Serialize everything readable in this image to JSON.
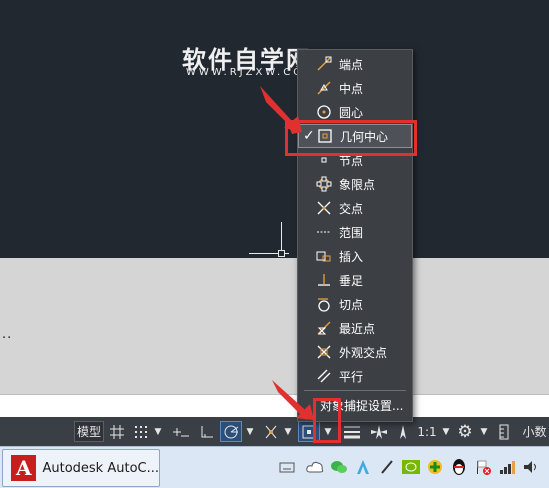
{
  "watermark": {
    "title": "软件自学网",
    "url": "WWW.RJZXW.COM"
  },
  "command": {
    "history_text": ".."
  },
  "snap_menu": {
    "items": [
      {
        "label": "端点",
        "icon": "endpoint-icon",
        "checked": false
      },
      {
        "label": "中点",
        "icon": "midpoint-icon",
        "checked": false
      },
      {
        "label": "圆心",
        "icon": "center-icon",
        "checked": false
      },
      {
        "label": "几何中心",
        "icon": "geometric-center-icon",
        "checked": true
      },
      {
        "label": "节点",
        "icon": "node-icon",
        "checked": false
      },
      {
        "label": "象限点",
        "icon": "quadrant-icon",
        "checked": false
      },
      {
        "label": "交点",
        "icon": "intersection-icon",
        "checked": false
      },
      {
        "label": "范围",
        "icon": "extension-icon",
        "checked": false
      },
      {
        "label": "插入",
        "icon": "insertion-icon",
        "checked": false
      },
      {
        "label": "垂足",
        "icon": "perpendicular-icon",
        "checked": false
      },
      {
        "label": "切点",
        "icon": "tangent-icon",
        "checked": false
      },
      {
        "label": "最近点",
        "icon": "nearest-icon",
        "checked": false
      },
      {
        "label": "外观交点",
        "icon": "apparent-intersection-icon",
        "checked": false
      },
      {
        "label": "平行",
        "icon": "parallel-icon",
        "checked": false
      }
    ],
    "settings_label": "对象捕捉设置...",
    "check_mark": "✓"
  },
  "statusbar": {
    "model_label": "模型",
    "scale_label": "1:1",
    "decimal_label": "小数"
  },
  "taskbar": {
    "app_label": "Autodesk AutoC...",
    "app_logo": "A"
  },
  "colors": {
    "canvas": "#212830",
    "menu": "#3c3f44",
    "highlight_red": "#e03030",
    "snap_orange": "#e8a040"
  }
}
